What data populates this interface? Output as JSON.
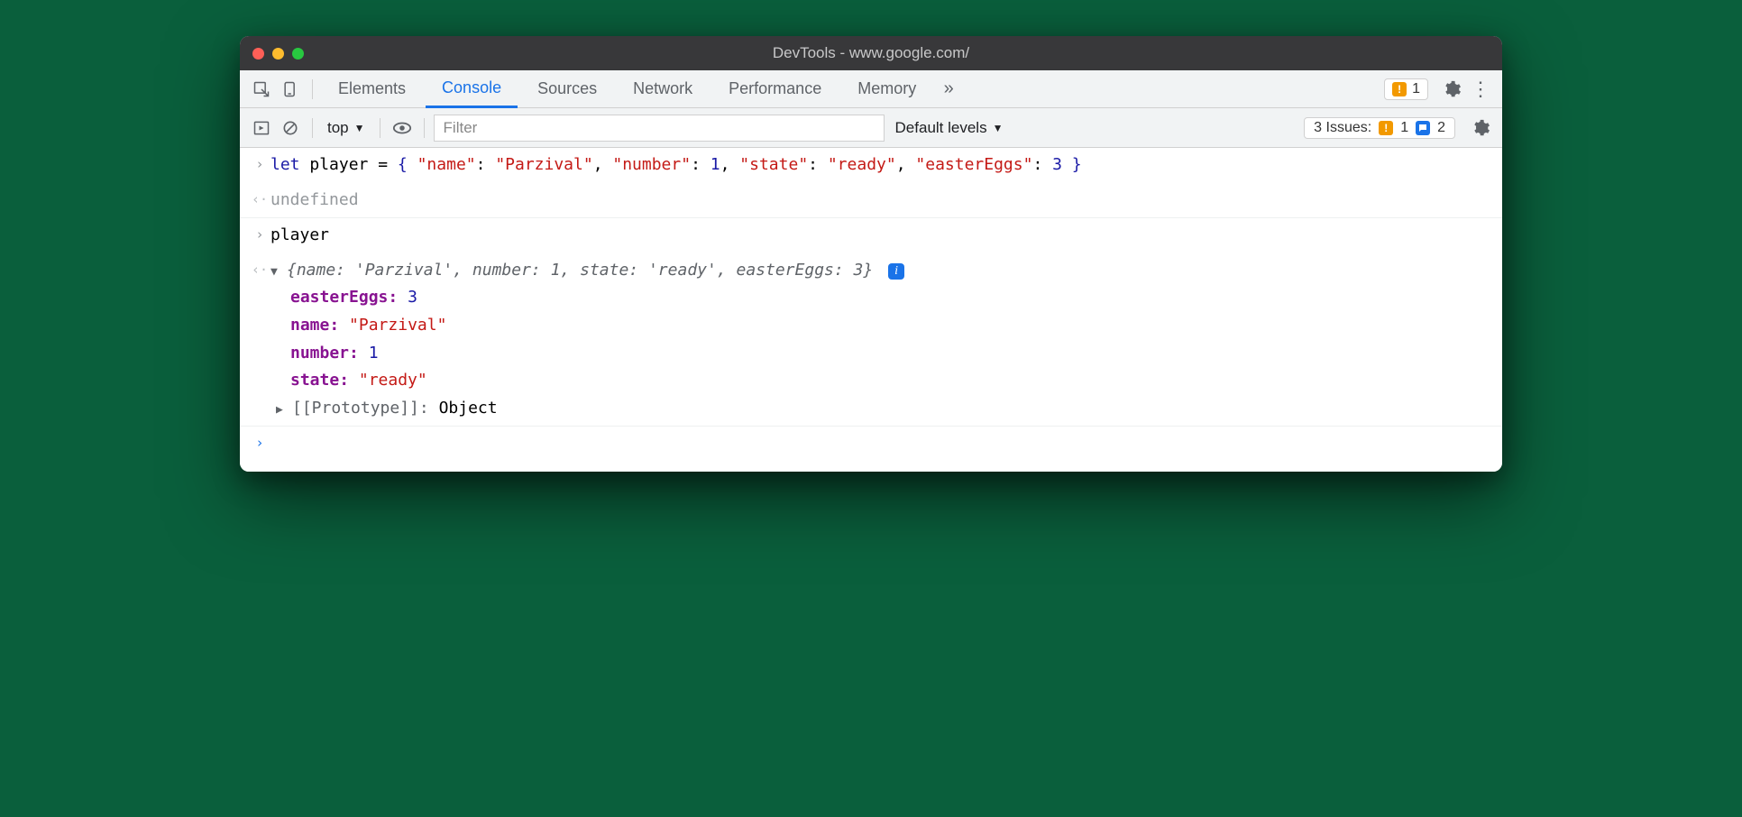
{
  "window": {
    "title": "DevTools - www.google.com/"
  },
  "tabs": {
    "elements": "Elements",
    "console": "Console",
    "sources": "Sources",
    "network": "Network",
    "performance": "Performance",
    "memory": "Memory",
    "warn_count": "1"
  },
  "toolbar": {
    "context": "top",
    "filter_placeholder": "Filter",
    "levels": "Default levels",
    "issues_label": "3 Issues:",
    "issues_warn": "1",
    "issues_info": "2"
  },
  "console": {
    "input1": {
      "kw": "let",
      "var": "player",
      "eq": " = ",
      "brace_open": "{ ",
      "k1": "\"name\"",
      "c1": ": ",
      "v1": "\"Parzival\"",
      "k2": "\"number\"",
      "c2": ": ",
      "v2": "1",
      "k3": "\"state\"",
      "c3": ": ",
      "v3": "\"ready\"",
      "k4": "\"easterEggs\"",
      "c4": ": ",
      "v4": "3",
      "brace_close": " }"
    },
    "result1": "undefined",
    "input2": "player",
    "output_summary": "{name: 'Parzival', number: 1, state: 'ready', easterEggs: 3}",
    "props": {
      "easterEggs_k": "easterEggs",
      "easterEggs_v": "3",
      "name_k": "name",
      "name_v": "\"Parzival\"",
      "number_k": "number",
      "number_v": "1",
      "state_k": "state",
      "state_v": "\"ready\""
    },
    "proto_k": "[[Prototype]]",
    "proto_v": "Object"
  }
}
